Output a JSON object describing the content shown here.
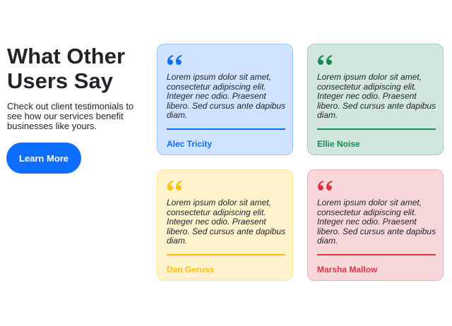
{
  "intro": {
    "heading": "What Other Users Say",
    "description": "Check out client testimonials to see how our services benefit businesses like yours.",
    "button_label": "Learn More"
  },
  "colors": {
    "primary": "#0d6efd",
    "blue_accent": "#0d6efd",
    "green_accent": "#198754",
    "yellow_accent": "#ffc107",
    "red_accent": "#dc3545"
  },
  "testimonials": [
    {
      "quote_icon": "quote-icon",
      "text": "Lorem ipsum dolor sit amet, consectetur adipiscing elit. Integer nec odio. Praesent libero. Sed cursus ante dapibus diam.",
      "author": "Alec Tricity"
    },
    {
      "quote_icon": "quote-icon",
      "text": "Lorem ipsum dolor sit amet, consectetur adipiscing elit. Integer nec odio. Praesent libero. Sed cursus ante dapibus diam.",
      "author": "Ellie Noise"
    },
    {
      "quote_icon": "quote-icon",
      "text": "Lorem ipsum dolor sit amet, consectetur adipiscing elit. Integer nec odio. Praesent libero. Sed cursus ante dapibus diam.",
      "author": "Dan Geruss"
    },
    {
      "quote_icon": "quote-icon",
      "text": "Lorem ipsum dolor sit amet, consectetur adipiscing elit. Integer nec odio. Praesent libero. Sed cursus ante dapibus diam.",
      "author": "Marsha Mallow"
    }
  ]
}
